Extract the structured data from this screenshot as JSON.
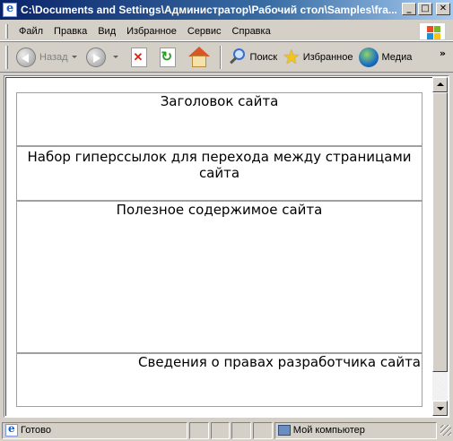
{
  "window": {
    "title": "C:\\Documents and Settings\\Администратор\\Рабочий стол\\Samples\\fra...",
    "minimize": "_",
    "maximize": "□",
    "close": "✕"
  },
  "menu": {
    "items": [
      "Файл",
      "Правка",
      "Вид",
      "Избранное",
      "Сервис",
      "Справка"
    ]
  },
  "toolbar": {
    "back_label": "Назад",
    "search_label": "Поиск",
    "favorites_label": "Избранное",
    "media_label": "Медиа",
    "more": "»"
  },
  "page": {
    "header": "Заголовок сайта",
    "nav": "Набор гиперссылок для перехода между страницами сайта",
    "main": "Полезное содержимое сайта",
    "footer": "Сведения о правах разработчика сайта"
  },
  "status": {
    "text": "Готово",
    "zone": "Мой компьютер"
  }
}
